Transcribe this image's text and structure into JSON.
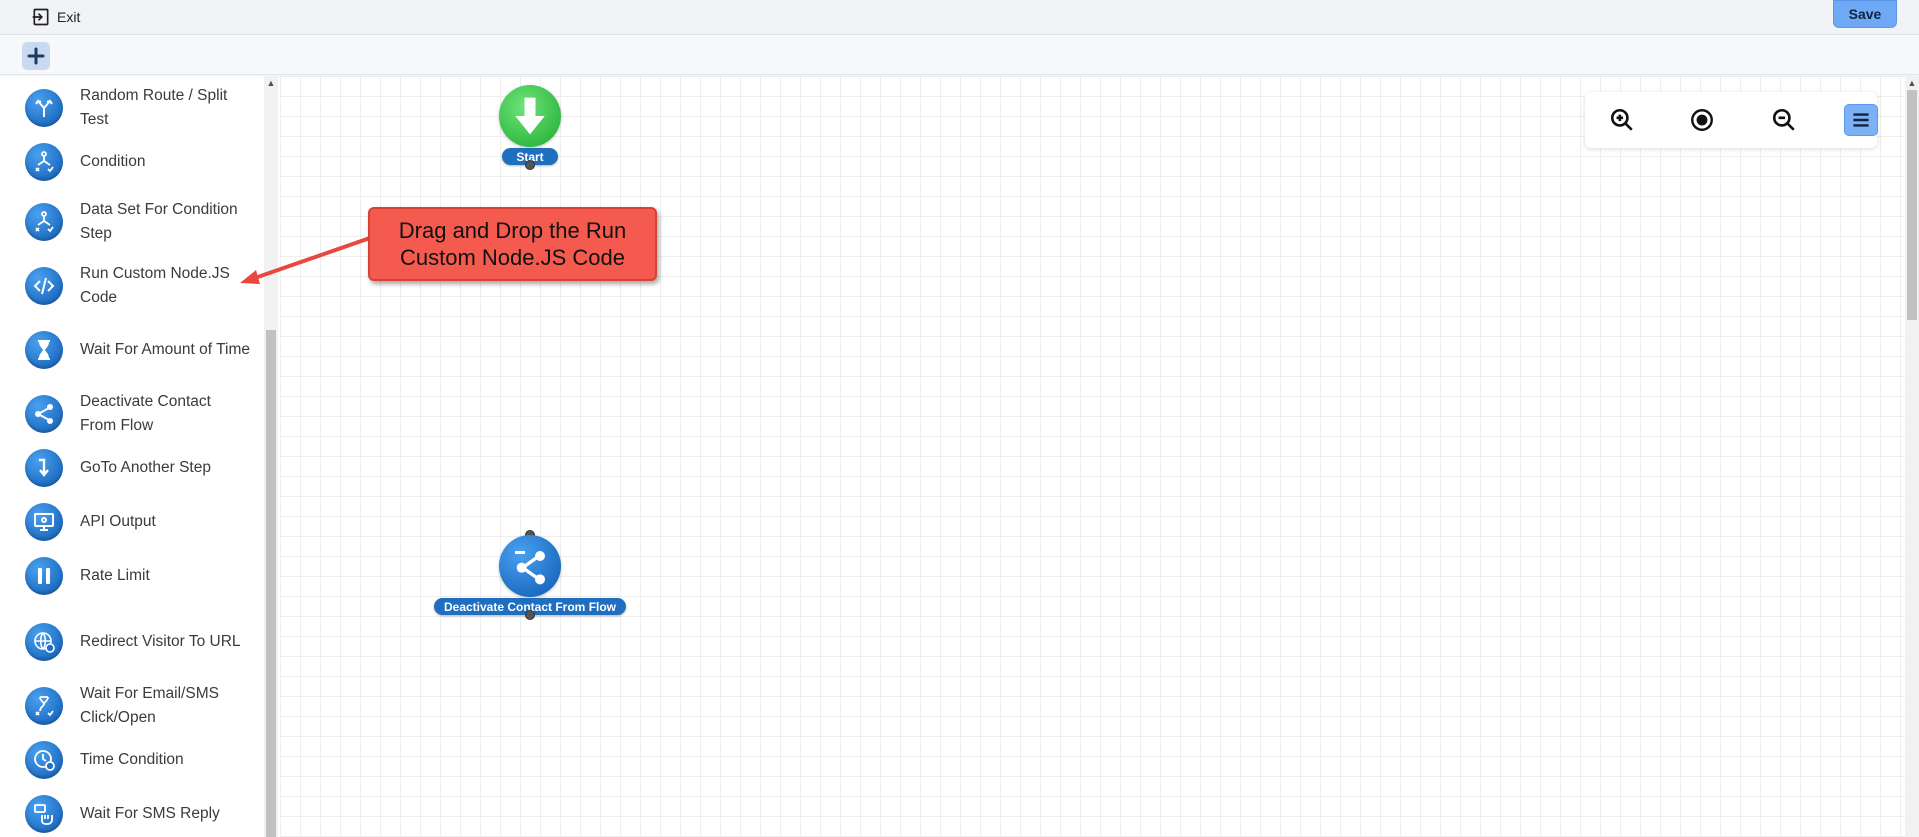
{
  "header": {
    "exit_label": "Exit",
    "save_label": "Save"
  },
  "sidebar": {
    "items": [
      {
        "label": "Random Route / Split Test",
        "icon": "split-route-icon"
      },
      {
        "label": "Condition",
        "icon": "condition-icon"
      },
      {
        "label": "Data Set For Condition Step",
        "icon": "dataset-condition-icon"
      },
      {
        "label": "Run Custom Node.JS Code",
        "icon": "code-icon"
      },
      {
        "label": "Wait For Amount of Time",
        "icon": "hourglass-icon"
      },
      {
        "label": "Deactivate Contact From Flow",
        "icon": "share-icon"
      },
      {
        "label": "GoTo Another Step",
        "icon": "goto-arrow-icon"
      },
      {
        "label": "API Output",
        "icon": "monitor-icon"
      },
      {
        "label": "Rate Limit",
        "icon": "pause-icon"
      },
      {
        "label": "Redirect Visitor To URL",
        "icon": "globe-icon"
      },
      {
        "label": "Wait For Email/SMS Click/Open",
        "icon": "wait-click-icon"
      },
      {
        "label": "Time Condition",
        "icon": "clock-icon"
      },
      {
        "label": "Wait For SMS Reply",
        "icon": "sms-reply-icon"
      }
    ]
  },
  "canvas": {
    "nodes": [
      {
        "label": "Start",
        "icon": "arrow-down-icon",
        "color": "#34bc45"
      },
      {
        "label": "Deactivate Contact From Flow",
        "icon": "share-icon",
        "color": "#1f6fc4"
      }
    ],
    "annotation": "Drag and Drop the Run Custom Node.JS Code"
  },
  "toolbar": {
    "buttons": [
      "zoom-in-icon",
      "center-icon",
      "zoom-out-icon",
      "menu-icon"
    ]
  },
  "colors": {
    "accent": "#1f6fc4",
    "save": "#6fa8f5",
    "callout": "#f55a4e",
    "start": "#34bc45"
  }
}
